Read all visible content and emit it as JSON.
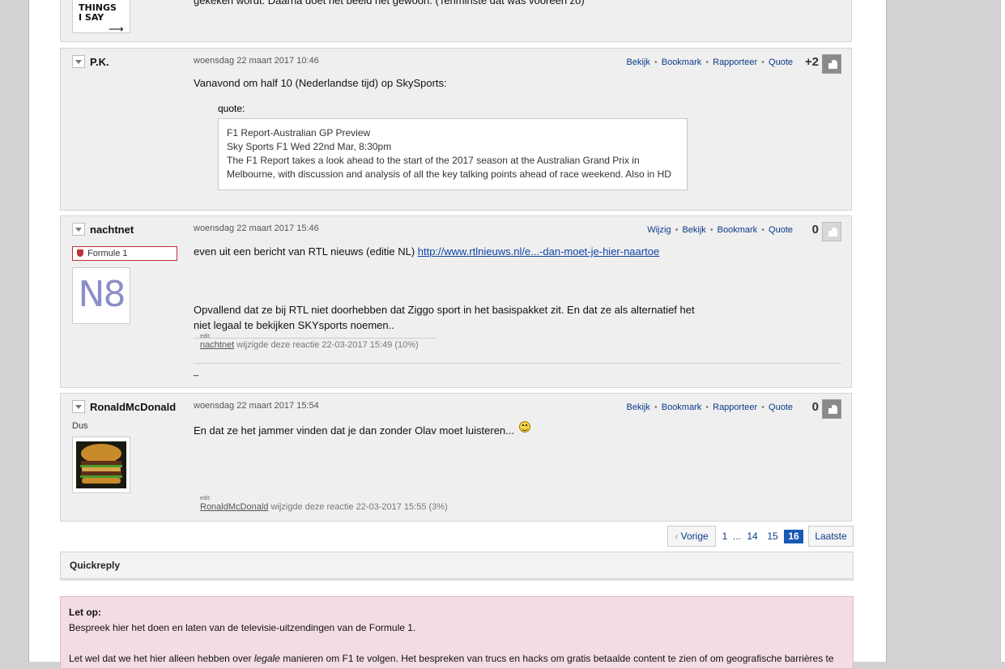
{
  "post0": {
    "avatar_text": "THINGS\nI SAY",
    "text": "gekeken wordt. Daarna doet het beeld het gewoon. (Tenminste dat was vooreen zo)"
  },
  "post1": {
    "username": "P.K.",
    "date": "woensdag 22 maart 2017 10:46",
    "actions": [
      "Bekijk",
      "Bookmark",
      "Rapporteer",
      "Quote"
    ],
    "score": "+2",
    "text": "Vanavond om half 10 (Nederlandse tijd) op SkySports:",
    "quote_label": "quote:",
    "quote_lines": [
      "F1 Report-Australian GP Preview",
      "Sky Sports F1 Wed 22nd Mar, 8:30pm",
      "The F1 Report takes a look ahead to the start of the 2017 season at the Australian Grand Prix in",
      "Melbourne, with discussion and analysis of all the key talking points ahead of race weekend. Also in HD"
    ]
  },
  "post2": {
    "username": "nachtnet",
    "badge": "Formule 1",
    "avatar_text": "N8",
    "date": "woensdag 22 maart 2017 15:46",
    "actions": [
      "Wijzig",
      "Bekijk",
      "Bookmark",
      "Quote"
    ],
    "score": "0",
    "text_prefix": "even uit een bericht van RTL nieuws (editie NL) ",
    "link": "http://www.rtlnieuws.nl/e...-dan-moet-je-hier-naartoe",
    "text2_line1": "Opvallend dat ze bij RTL niet doorhebben dat Ziggo sport in het basispakket zit. En dat ze als alternatief het",
    "text2_line2": "niet legaal te bekijken SKYsports noemen..",
    "edit_small": "edit:",
    "edit_user": "nachtnet",
    "edit_rest": " wijzigde deze reactie 22-03-2017 15:49 (10%)",
    "signature": "_"
  },
  "post3": {
    "username": "RonaldMcDonald",
    "subtitle": "Dus",
    "date": "woensdag 22 maart 2017 15:54",
    "actions": [
      "Bekijk",
      "Bookmark",
      "Rapporteer",
      "Quote"
    ],
    "score": "0",
    "text": "En dat ze het jammer vinden dat je dan zonder Olav moet luisteren...",
    "edit_small": "edit:",
    "edit_user": "RonaldMcDonald",
    "edit_rest": " wijzigde deze reactie 22-03-2017 15:55 (3%)"
  },
  "pager": {
    "prev": "Vorige",
    "pages": [
      "1",
      "...",
      "14",
      "15"
    ],
    "current": "16",
    "last": "Laatste"
  },
  "quickreply": "Quickreply",
  "notice": {
    "title": "Let op:",
    "line1": "Bespreek hier het doen en laten van de televisie-uitzendingen van de Formule 1.",
    "line2_a": "Let wel dat we het hier alleen hebben over ",
    "line2_em": "legale",
    "line2_b": " manieren om F1 te volgen. Het bespreken van trucs en hacks om gratis betaalde content te zien of om geografische barrières te"
  },
  "colors": {
    "link": "#0a3b8a",
    "current_page": "#1a59b4",
    "badge_border": "#c0303a",
    "notice_bg": "#f3dde3"
  }
}
